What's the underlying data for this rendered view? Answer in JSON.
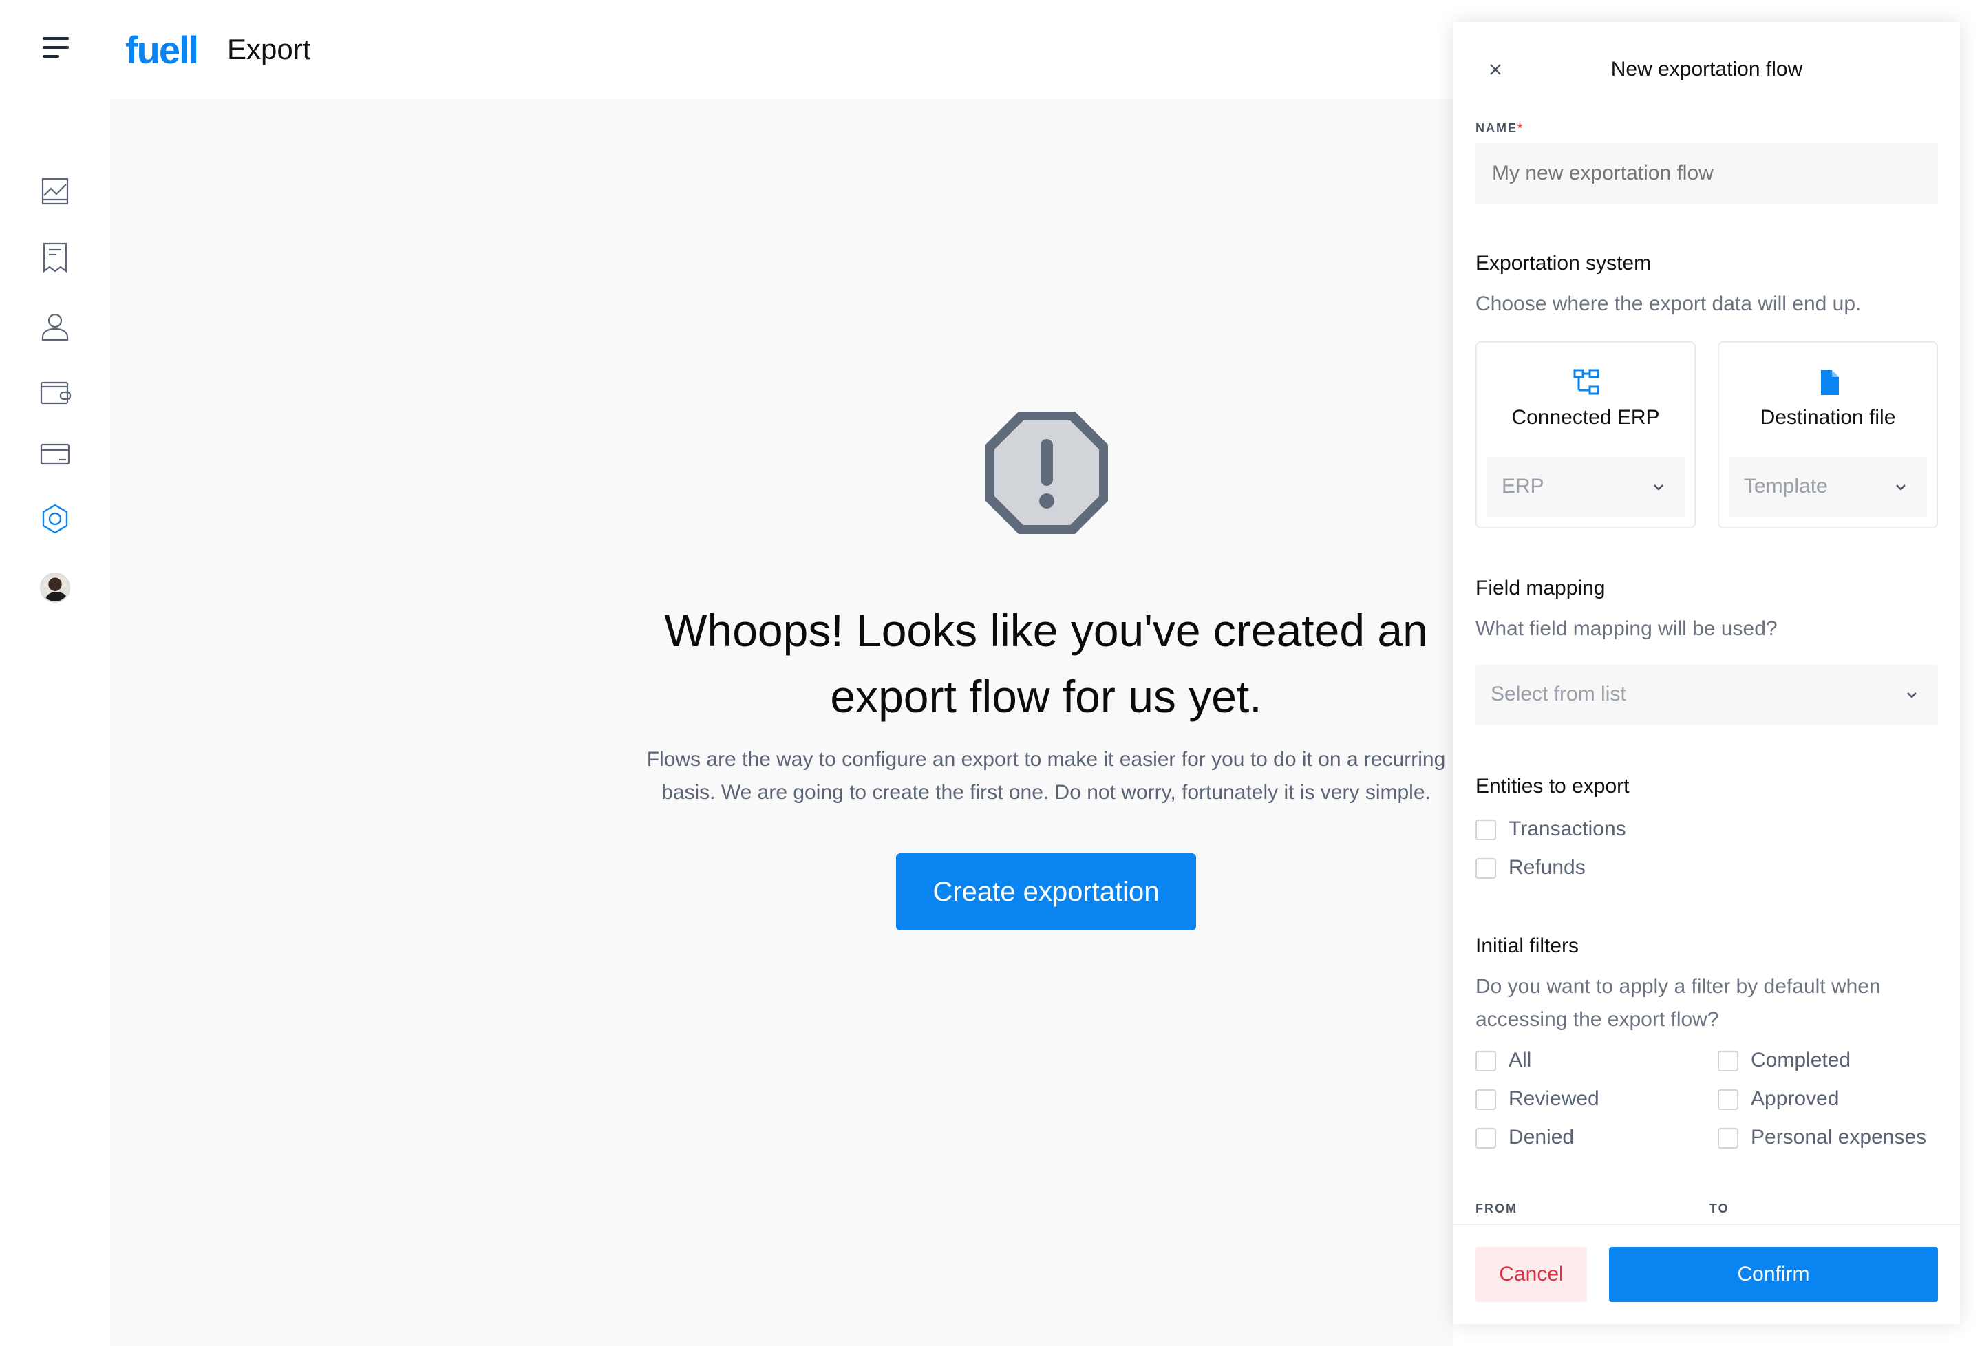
{
  "header": {
    "logo": "fuell",
    "title": "Export"
  },
  "sidebar": {
    "items": [
      {
        "name": "chart-icon"
      },
      {
        "name": "receipt-icon"
      },
      {
        "name": "user-icon"
      },
      {
        "name": "wallet-icon"
      },
      {
        "name": "card-icon"
      },
      {
        "name": "settings-hex-icon"
      }
    ],
    "active_color": "#0a84f0"
  },
  "main": {
    "title_line1": "Whoops! Looks like you've created an",
    "title_line2": "export flow for us yet.",
    "desc_line1": "Flows are the way to configure an export to make it easier for you to do it on a recurring",
    "desc_line2": "basis. We are going to create the first one. Do not worry, fortunately it is very simple.",
    "create_button": "Create exportation"
  },
  "drawer": {
    "title": "New exportation flow",
    "name_label": "NAME",
    "name_required": "*",
    "name_placeholder": "My new exportation flow",
    "system_title": "Exportation system",
    "system_sub": "Choose where the export data will end up.",
    "cards": [
      {
        "title": "Connected ERP",
        "select": "ERP",
        "icon": "erp-icon"
      },
      {
        "title": "Destination file",
        "select": "Template",
        "icon": "file-icon"
      }
    ],
    "mapping_title": "Field mapping",
    "mapping_sub": "What field mapping will be used?",
    "mapping_select": "Select from list",
    "entities_title": "Entities to export",
    "entities": [
      "Transactions",
      "Refunds"
    ],
    "filters_title": "Initial filters",
    "filters_sub": "Do you want to apply a filter by default when accessing the export flow?",
    "filters": [
      "All",
      "Completed",
      "Reviewed",
      "Approved",
      "Denied",
      "Personal expenses"
    ],
    "from_label": "FROM",
    "to_label": "TO",
    "cancel": "Cancel",
    "confirm": "Confirm"
  }
}
